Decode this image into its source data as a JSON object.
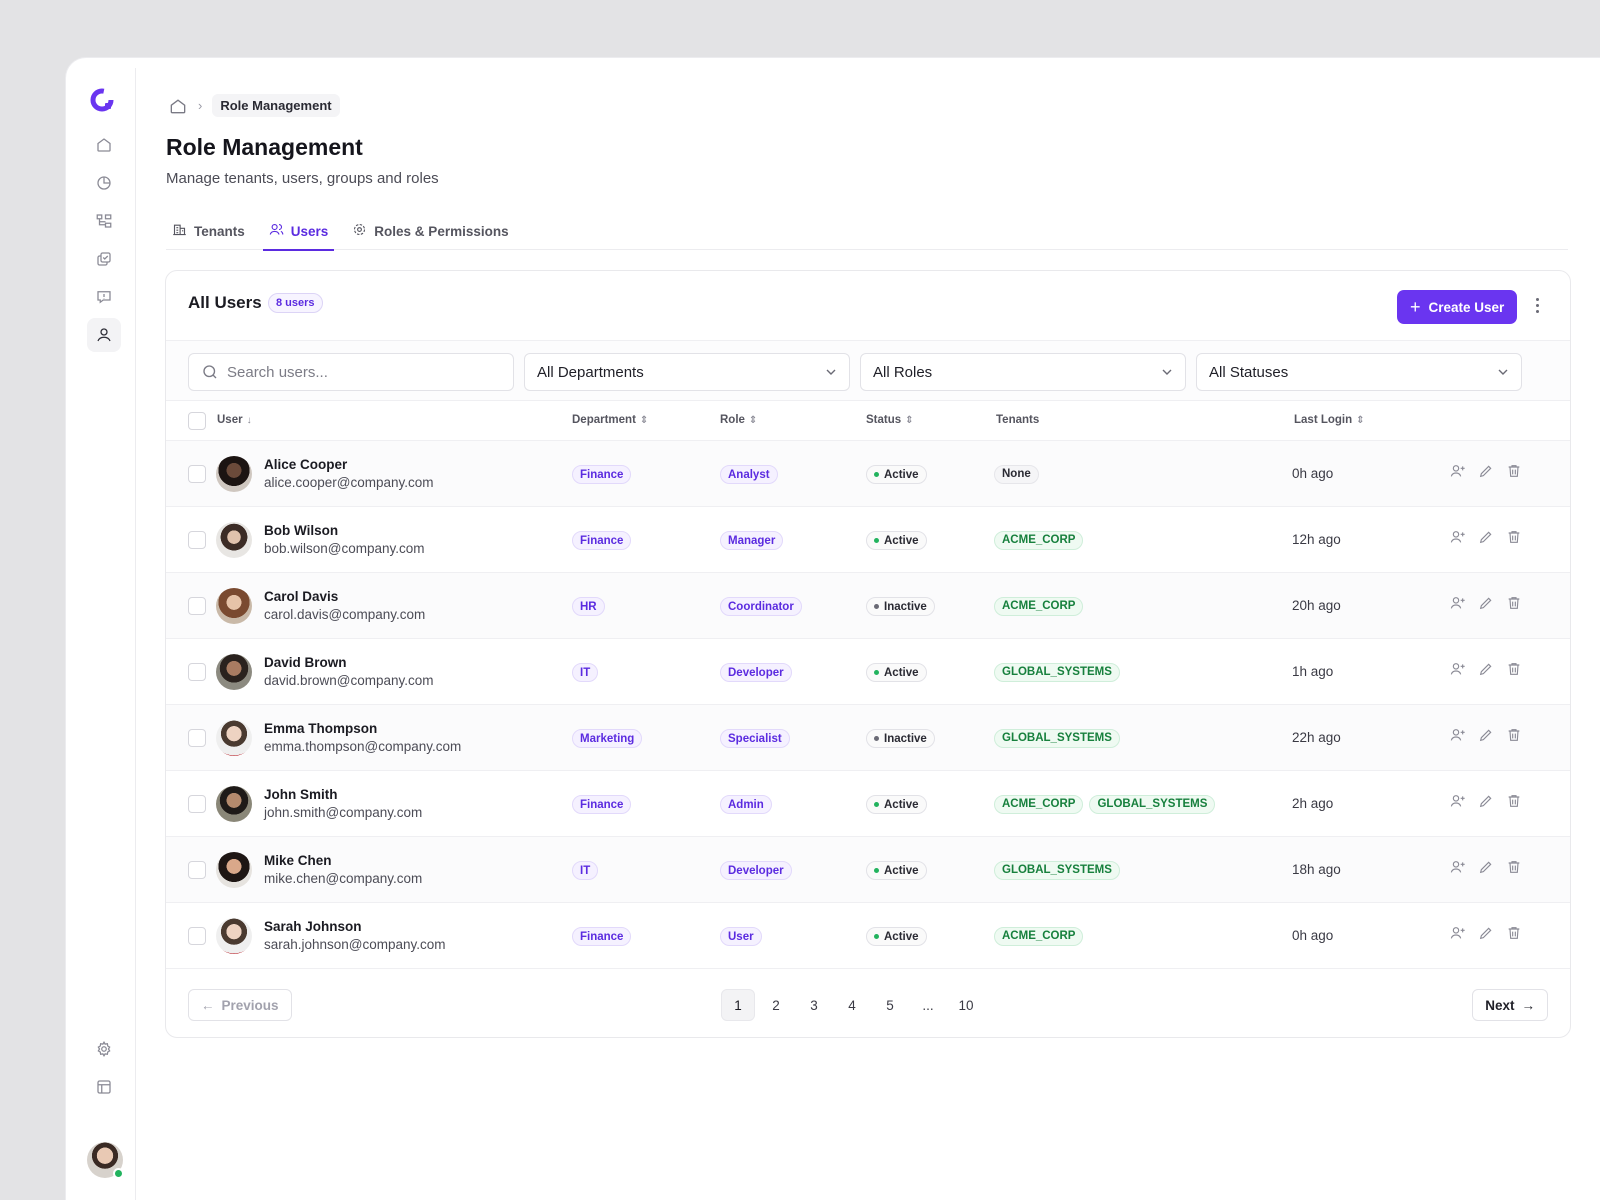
{
  "sidebar": {
    "logo": "brand-logo",
    "items": [
      {
        "name": "home",
        "icon": "home-icon"
      },
      {
        "name": "analytics",
        "icon": "pie-chart-icon"
      },
      {
        "name": "structure",
        "icon": "hierarchy-icon"
      },
      {
        "name": "tasks",
        "icon": "copy-check-icon"
      },
      {
        "name": "reports",
        "icon": "message-alert-icon"
      },
      {
        "name": "users",
        "icon": "user-icon",
        "active": true
      }
    ],
    "bottom": [
      {
        "name": "settings",
        "icon": "gear-icon"
      },
      {
        "name": "layout",
        "icon": "layout-icon"
      }
    ]
  },
  "breadcrumb": {
    "current": "Role Management"
  },
  "page": {
    "title": "Role Management",
    "subtitle": "Manage tenants, users, groups and roles"
  },
  "tabs": [
    {
      "label": "Tenants",
      "icon": "building-icon"
    },
    {
      "label": "Users",
      "icon": "users-icon",
      "active": true
    },
    {
      "label": "Roles & Permissions",
      "icon": "gear-icon"
    }
  ],
  "card": {
    "title": "All Users",
    "count": "8 users",
    "create_label": "Create User"
  },
  "filters": {
    "search_placeholder": "Search users...",
    "department": "All Departments",
    "role": "All Roles",
    "status": "All Statuses"
  },
  "columns": {
    "user": "User",
    "department": "Department",
    "role": "Role",
    "status": "Status",
    "tenants": "Tenants",
    "last_login": "Last Login"
  },
  "users": [
    {
      "name": "Alice Cooper",
      "email": "alice.cooper@company.com",
      "department": "Finance",
      "role": "Analyst",
      "status": "Active",
      "tenants": [
        "None"
      ],
      "last_login": "0h ago"
    },
    {
      "name": "Bob Wilson",
      "email": "bob.wilson@company.com",
      "department": "Finance",
      "role": "Manager",
      "status": "Active",
      "tenants": [
        "ACME_CORP"
      ],
      "last_login": "12h ago"
    },
    {
      "name": "Carol Davis",
      "email": "carol.davis@company.com",
      "department": "HR",
      "role": "Coordinator",
      "status": "Inactive",
      "tenants": [
        "ACME_CORP"
      ],
      "last_login": "20h ago"
    },
    {
      "name": "David Brown",
      "email": "david.brown@company.com",
      "department": "IT",
      "role": "Developer",
      "status": "Active",
      "tenants": [
        "GLOBAL_SYSTEMS"
      ],
      "last_login": "1h ago"
    },
    {
      "name": "Emma Thompson",
      "email": "emma.thompson@company.com",
      "department": "Marketing",
      "role": "Specialist",
      "status": "Inactive",
      "tenants": [
        "GLOBAL_SYSTEMS"
      ],
      "last_login": "22h ago"
    },
    {
      "name": "John Smith",
      "email": "john.smith@company.com",
      "department": "Finance",
      "role": "Admin",
      "status": "Active",
      "tenants": [
        "ACME_CORP",
        "GLOBAL_SYSTEMS"
      ],
      "last_login": "2h ago"
    },
    {
      "name": "Mike Chen",
      "email": "mike.chen@company.com",
      "department": "IT",
      "role": "Developer",
      "status": "Active",
      "tenants": [
        "GLOBAL_SYSTEMS"
      ],
      "last_login": "18h ago"
    },
    {
      "name": "Sarah Johnson",
      "email": "sarah.johnson@company.com",
      "department": "Finance",
      "role": "User",
      "status": "Active",
      "tenants": [
        "ACME_CORP"
      ],
      "last_login": "0h ago"
    }
  ],
  "pagination": {
    "previous": "Previous",
    "next": "Next",
    "pages": [
      "1",
      "2",
      "3",
      "4",
      "5",
      "...",
      "10"
    ],
    "current": "1"
  },
  "colors": {
    "accent": "#6a35f0",
    "active_dot": "#22b35e",
    "inactive_dot": "#6a6a75",
    "tenant_text": "#17803d"
  }
}
